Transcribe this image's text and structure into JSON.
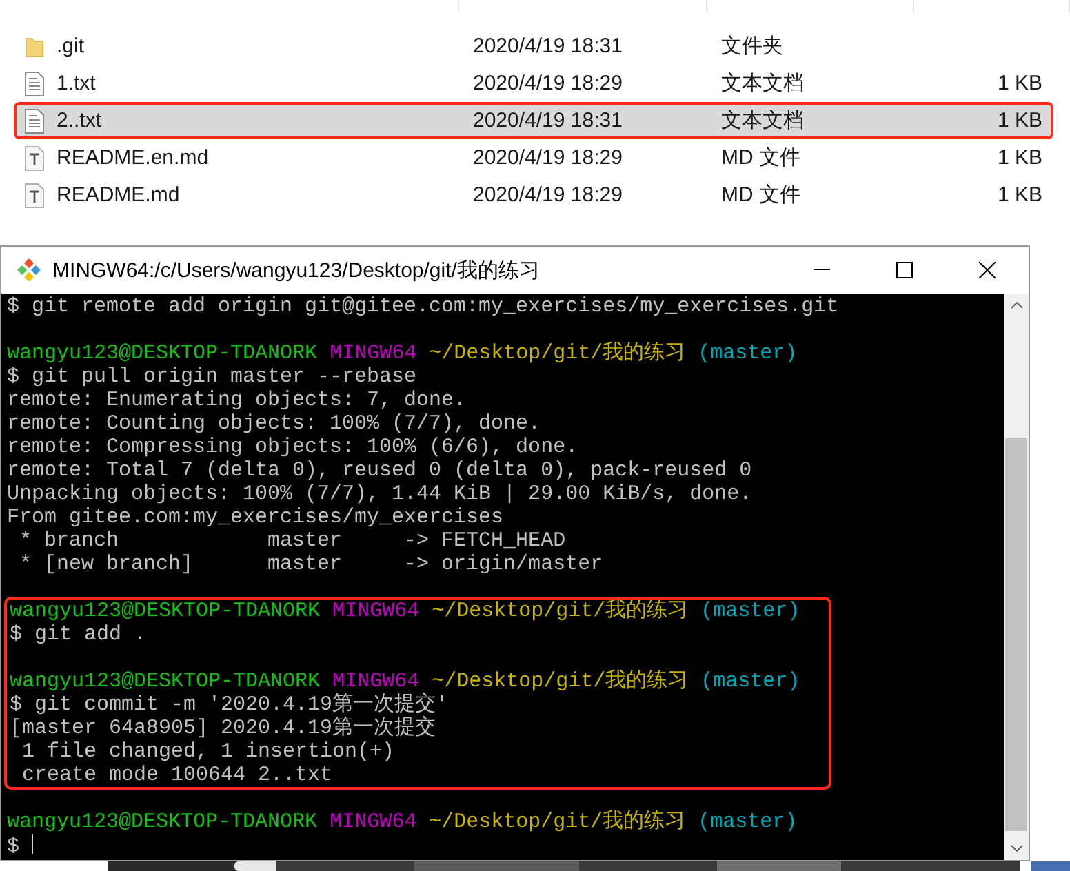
{
  "explorer": {
    "files": [
      {
        "kind": "folder",
        "name": ".git",
        "modified": "2020/4/19 18:31",
        "type": "文件夹",
        "selected": false,
        "highlighted": false
      },
      {
        "kind": "text",
        "name": "1.txt",
        "modified": "2020/4/19 18:29",
        "type": "文本文档",
        "size": "1 KB",
        "selected": false,
        "highlighted": false
      },
      {
        "kind": "text",
        "name": "2..txt",
        "modified": "2020/4/19 18:31",
        "type": "文本文档",
        "size": "1 KB",
        "selected": true,
        "highlighted": true
      },
      {
        "kind": "markdown",
        "name": "README.en.md",
        "modified": "2020/4/19 18:29",
        "type": "MD 文件",
        "size": "1 KB",
        "selected": false,
        "highlighted": false
      },
      {
        "kind": "markdown",
        "name": "README.md",
        "modified": "2020/4/19 18:29",
        "type": "MD 文件",
        "size": "1 KB",
        "selected": false,
        "highlighted": false
      }
    ]
  },
  "terminal": {
    "title": "MINGW64:/c/Users/wangyu123/Desktop/git/我的练习",
    "blocks": [
      {
        "highlighted": false,
        "lines": [
          {
            "kind": "output",
            "text": "$ git remote add origin git@gitee.com:my_exercises/my_exercises.git"
          },
          {
            "kind": "blank"
          },
          {
            "kind": "prompt",
            "user": "wangyu123@DESKTOP-TDANORK",
            "system": "MINGW64",
            "path": "~/Desktop/git/我的练习",
            "branch": "(master)"
          },
          {
            "kind": "output",
            "text": "$ git pull origin master --rebase"
          },
          {
            "kind": "output",
            "text": "remote: Enumerating objects: 7, done."
          },
          {
            "kind": "output",
            "text": "remote: Counting objects: 100% (7/7), done."
          },
          {
            "kind": "output",
            "text": "remote: Compressing objects: 100% (6/6), done."
          },
          {
            "kind": "output",
            "text": "remote: Total 7 (delta 0), reused 0 (delta 0), pack-reused 0"
          },
          {
            "kind": "output",
            "text": "Unpacking objects: 100% (7/7), 1.44 KiB | 29.00 KiB/s, done."
          },
          {
            "kind": "output",
            "text": "From gitee.com:my_exercises/my_exercises"
          },
          {
            "kind": "output",
            "text": " * branch            master     -> FETCH_HEAD"
          },
          {
            "kind": "output",
            "text": " * [new branch]      master     -> origin/master"
          },
          {
            "kind": "blank"
          }
        ]
      },
      {
        "highlighted": true,
        "lines": [
          {
            "kind": "prompt",
            "user": "wangyu123@DESKTOP-TDANORK",
            "system": "MINGW64",
            "path": "~/Desktop/git/我的练习",
            "branch": "(master)"
          },
          {
            "kind": "output",
            "text": "$ git add ."
          },
          {
            "kind": "blank"
          },
          {
            "kind": "prompt",
            "user": "wangyu123@DESKTOP-TDANORK",
            "system": "MINGW64",
            "path": "~/Desktop/git/我的练习",
            "branch": "(master)"
          },
          {
            "kind": "output",
            "text": "$ git commit -m '2020.4.19第一次提交'"
          },
          {
            "kind": "output",
            "text": "[master 64a8905] 2020.4.19第一次提交"
          },
          {
            "kind": "output",
            "text": " 1 file changed, 1 insertion(+)"
          },
          {
            "kind": "output",
            "text": " create mode 100644 2..txt"
          }
        ]
      },
      {
        "highlighted": false,
        "lines": [
          {
            "kind": "blank"
          },
          {
            "kind": "prompt",
            "user": "wangyu123@DESKTOP-TDANORK",
            "system": "MINGW64",
            "path": "~/Desktop/git/我的练习",
            "branch": "(master)"
          },
          {
            "kind": "input",
            "text": "$"
          }
        ]
      }
    ]
  }
}
